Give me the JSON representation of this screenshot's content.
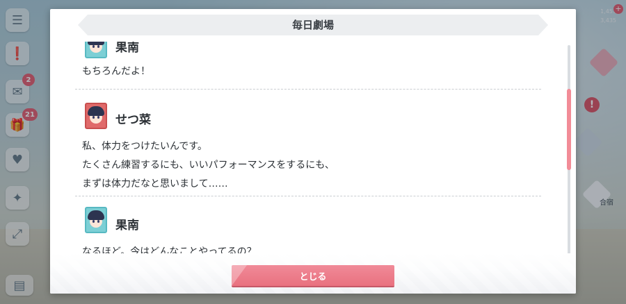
{
  "dialog": {
    "title": "毎日劇場",
    "close_label": "とじる"
  },
  "entries": [
    {
      "speaker": "果南",
      "avatar": "kanan-avatar",
      "lines": [
        "もちろんだよ！"
      ]
    },
    {
      "speaker": "せつ菜",
      "avatar": "setsuna-avatar",
      "lines": [
        "私、体力をつけたいんです。",
        "たくさん練習するにも、いいパフォーマンスをするにも、",
        "まずは体力だなと思いまして……"
      ]
    },
    {
      "speaker": "果南",
      "avatar": "kanan-avatar",
      "lines": [
        "なるほど。今はどんなことやってるの？"
      ]
    }
  ],
  "background": {
    "badges": [
      "2",
      "21"
    ],
    "currency": [
      "1,457",
      "3,435"
    ],
    "right_label": "合宿"
  },
  "colors": {
    "accent": "#f08a98",
    "kanan": "#7ccfd5",
    "setsuna": "#e06a6a",
    "header": "#eceef0"
  }
}
